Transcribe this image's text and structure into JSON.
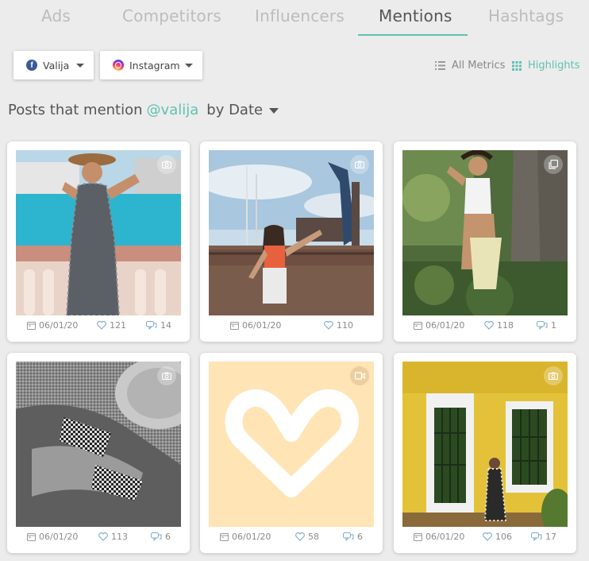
{
  "tabs": [
    {
      "label": "Ads",
      "active": false
    },
    {
      "label": "Competitors",
      "active": false
    },
    {
      "label": "Influencers",
      "active": false
    },
    {
      "label": "Mentions",
      "active": true
    },
    {
      "label": "Hashtags",
      "active": false
    }
  ],
  "filters": {
    "facebook": {
      "label": "Valija",
      "icon": "facebook-icon"
    },
    "instagram": {
      "label": "Instagram",
      "icon": "instagram-icon"
    }
  },
  "views": {
    "all_metrics": "All Metrics",
    "highlights": "Highlights"
  },
  "section": {
    "prefix": "Posts that mention",
    "handle": "@valija",
    "sort_label": "by Date"
  },
  "colors": {
    "accent": "#5fc1b3",
    "tab_inactive": "#bcbcbc",
    "placeholder_bg": "#ffe4b5"
  },
  "posts": [
    {
      "date": "06/01/20",
      "likes": "121",
      "comments": "14",
      "type": "photo",
      "type_icon": "camera-icon",
      "scene": "woman in patterned jumpsuit by balcony railing"
    },
    {
      "date": "06/01/20",
      "likes": "110",
      "comments": "",
      "type": "photo",
      "type_icon": "camera-icon",
      "scene": "woman at marina with marlin statue"
    },
    {
      "date": "06/01/20",
      "likes": "118",
      "comments": "1",
      "type": "carousel",
      "type_icon": "carousel-icon",
      "scene": "woman by tree in garden"
    },
    {
      "date": "06/01/20",
      "likes": "113",
      "comments": "6",
      "type": "photo",
      "type_icon": "camera-icon",
      "scene": "black and white beach photo with hat"
    },
    {
      "date": "06/01/20",
      "likes": "58",
      "comments": "6",
      "type": "video",
      "type_icon": "video-icon",
      "scene": "placeholder heart"
    },
    {
      "date": "06/01/20",
      "likes": "106",
      "comments": "17",
      "type": "photo",
      "type_icon": "camera-icon",
      "scene": "woman by yellow wall with green windows"
    }
  ]
}
